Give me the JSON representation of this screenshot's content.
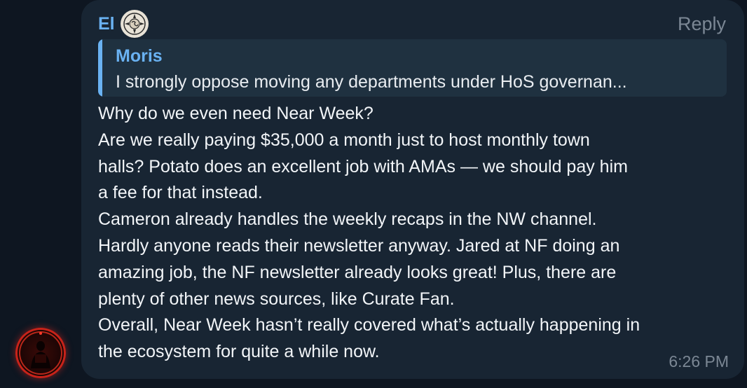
{
  "message": {
    "sender": "El",
    "reply_label": "Reply",
    "quote": {
      "author": "Moris",
      "text": "I strongly oppose moving any departments under HoS governan..."
    },
    "lines": [
      "Why do we even need Near Week?",
      "Are we really paying $35,000 a month just to host monthly town",
      "halls? Potato does an excellent job with AMAs — we should pay him",
      "a fee for that instead.",
      "Cameron already handles the weekly recaps in the NW channel.",
      "Hardly anyone reads their newsletter anyway. Jared at NF doing an",
      "amazing job, the NF newsletter already looks great! Plus, there are",
      "plenty of other news sources, like Curate Fan.",
      "Overall, Near Week hasn’t really covered what’s actually happening in",
      "the ecosystem for quite a while now."
    ],
    "time": "6:26 PM"
  },
  "icons": {
    "badge": "om-emblem-icon",
    "avatar": "red-ring-avatar"
  },
  "colors": {
    "background": "#0e1621",
    "bubble": "#182533",
    "name_accent": "#6ab2f2",
    "quote_bg": "#1f3140",
    "text": "#f2f5f8",
    "meta_text": "#7b8794",
    "avatar_ring": "#c8231a"
  }
}
